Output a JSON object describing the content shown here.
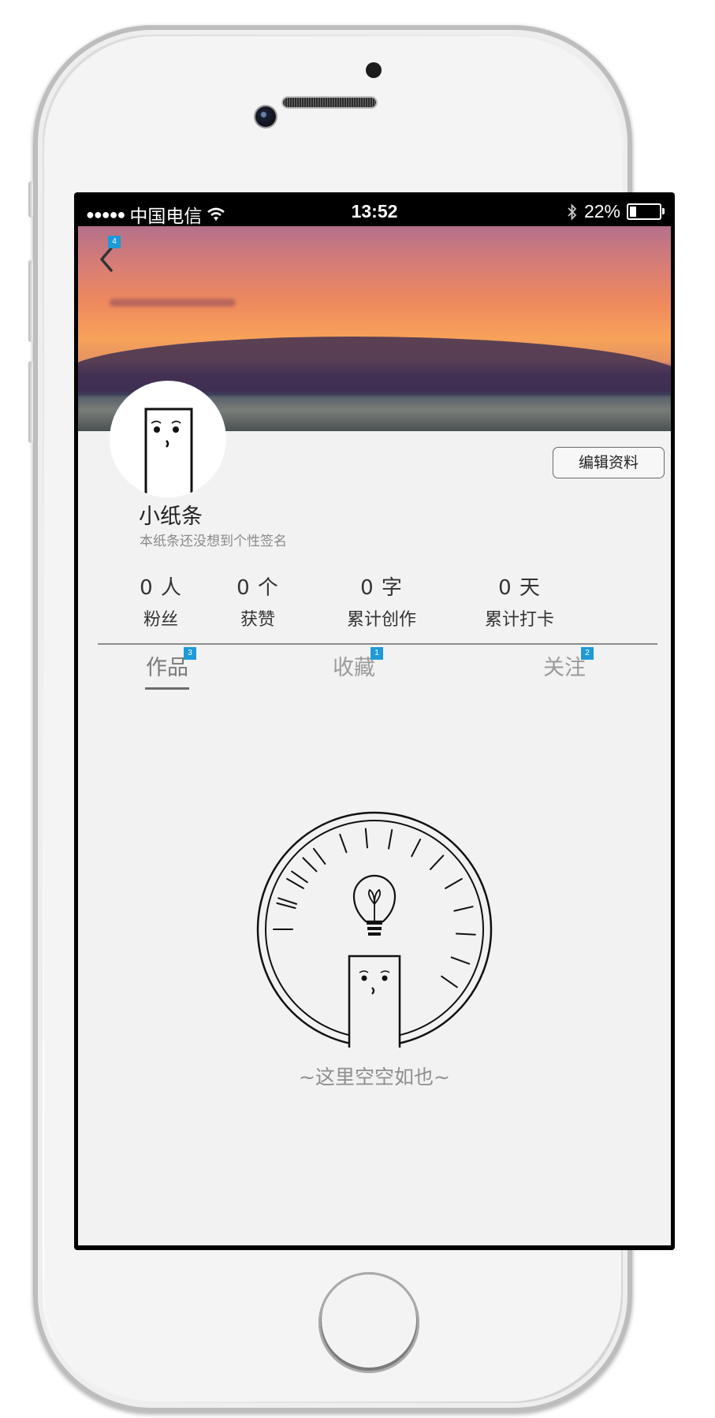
{
  "status_bar": {
    "signal": "●●●●●",
    "carrier": "中国电信",
    "time": "13:52",
    "battery_percent": "22%",
    "battery_level": 0.22
  },
  "header": {
    "back_badge": "4"
  },
  "profile": {
    "name": "小纸条",
    "signature": "本纸条还没想到个性签名",
    "edit_label": "编辑资料"
  },
  "stats": [
    {
      "value": "0 人",
      "label": "粉丝"
    },
    {
      "value": "0 个",
      "label": "获赞"
    },
    {
      "value": "0 字",
      "label": "累计创作"
    },
    {
      "value": "0 天",
      "label": "累计打卡"
    }
  ],
  "tabs": [
    {
      "label": "作品",
      "badge": "3",
      "active": true
    },
    {
      "label": "收藏",
      "badge": "1",
      "active": false
    },
    {
      "label": "关注",
      "badge": "2",
      "active": false
    }
  ],
  "empty_state": {
    "text": "~这里空空如也~"
  },
  "colors": {
    "badge": "#1e9ad6",
    "background": "#f2f2f2"
  }
}
